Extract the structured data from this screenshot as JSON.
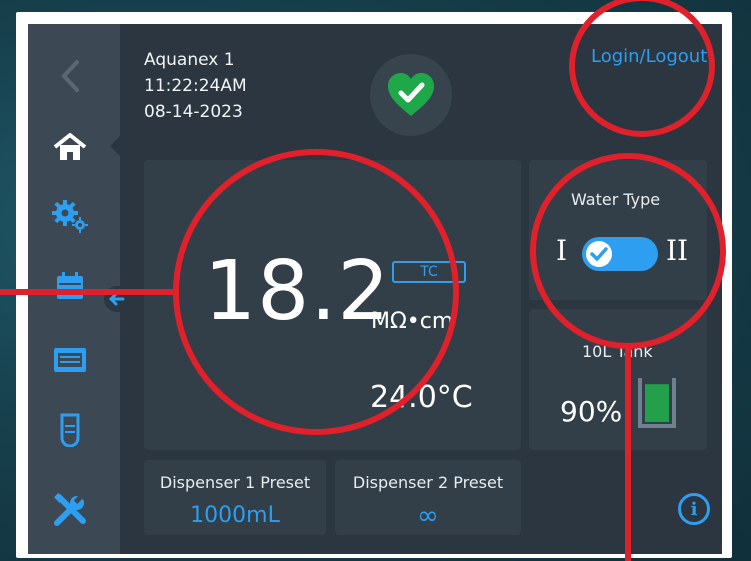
{
  "header": {
    "device_name": "Aquanex 1",
    "time": "11:22:24AM",
    "date": "08-14-2023",
    "login_label": "Login/Logout"
  },
  "resistivity": {
    "value": "18.2",
    "unit": "MΩ•cm",
    "tc_label": "TC",
    "temperature": "24.0°C"
  },
  "water_type": {
    "label": "Water Type",
    "option_left": "I",
    "option_right": "II"
  },
  "tank": {
    "label": "10L Tank",
    "level_text": "90%",
    "level_fraction": 0.9
  },
  "presets": [
    {
      "title": "Dispenser 1 Preset",
      "value": "1000mL"
    },
    {
      "title": "Dispenser 2 Preset",
      "value": "∞"
    }
  ],
  "sidebar": {
    "items": [
      {
        "icon": "back-chevron-icon"
      },
      {
        "icon": "home-icon"
      },
      {
        "icon": "settings-gears-icon"
      },
      {
        "icon": "calendar-icon"
      },
      {
        "icon": "display-panel-icon"
      },
      {
        "icon": "sample-tube-icon"
      },
      {
        "icon": "tools-icon"
      }
    ]
  },
  "colors": {
    "accent": "#2d9ef0",
    "status_ok": "#1fa84a",
    "annotation": "#e0202a",
    "tank_fill": "#22a04a"
  },
  "info_label": "i"
}
